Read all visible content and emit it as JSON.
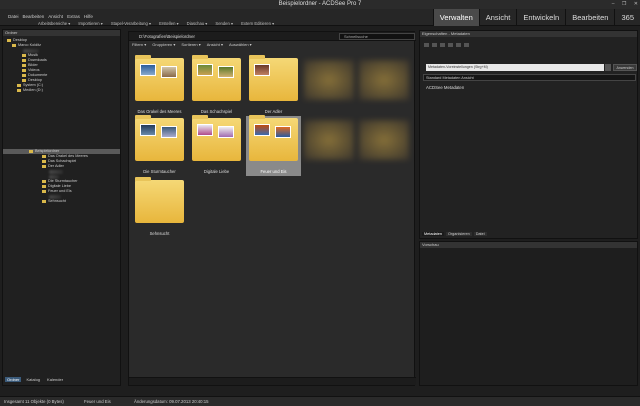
{
  "window": {
    "title": "Beispielordner - ACDSee Pro 7",
    "min": "–",
    "max": "❐",
    "close": "✕"
  },
  "menu": [
    "Datei",
    "Bearbeiten",
    "Ansicht",
    "Extras",
    "Hilfe"
  ],
  "toolbar": [
    "Arbeitsbereiche ▾",
    "Importieren ▾",
    "Stapel-Verarbeitung ▾",
    "Erstellen ▾",
    "Diaschau ▾",
    "Senden ▾",
    "Extern Editieren ▾"
  ],
  "modes": [
    "Verwalten",
    "Ansicht",
    "Entwickeln",
    "Bearbeiten",
    "365"
  ],
  "left_panel": {
    "header": "Ordner",
    "tree": [
      "Desktop",
      "Marco Kolditz",
      "Musik",
      "Downloads",
      "Bilder",
      "Videos",
      "Dokumente",
      "Desktop",
      "System (C:)",
      "Medien (D:)"
    ],
    "selected": "Beispielordner",
    "children": [
      "Das Orakel des Meeres",
      "Das Schachspiel",
      "Der Adler",
      "Die Sturmtaucher",
      "Digitale Liebe",
      "Feuer und Eis",
      "Sehnsucht"
    ],
    "tabs": [
      "Ordner",
      "Katalog",
      "Kalender"
    ]
  },
  "center": {
    "path": "D:\\Fotografien\\Beispielordner",
    "search_placeholder": "Schnellsuche",
    "filters": [
      "Filtern ▾",
      "Gruppieren ▾",
      "Sortieren ▾",
      "Ansicht ▾",
      "Auswählen ▾"
    ],
    "thumbs": [
      "Das Orakel des Meeres",
      "Das Schachspiel",
      "Der Adler",
      "Die Sturmtaucher",
      "Digitale Liebe",
      "Feuer und Eis",
      "Sehnsucht"
    ]
  },
  "right_panel": {
    "header": "Eigenschaften - Metadaten",
    "field": "Metadaten-Voreinstellungen (Strg+M)",
    "button": "Anwenden",
    "dropdown": "Standard Metadaten Ansicht",
    "section": "ACDSee Metadaten",
    "tabs": [
      "Metadaten",
      "Organisieren",
      "Datei"
    ]
  },
  "preview": {
    "header": "Vorschau"
  },
  "status": {
    "count": "Insgesamt 11 Objekte (0 Bytes)",
    "selected": "Feuer und Eis",
    "date": "Änderungsdatum: 09.07.2013 20:40:15"
  }
}
